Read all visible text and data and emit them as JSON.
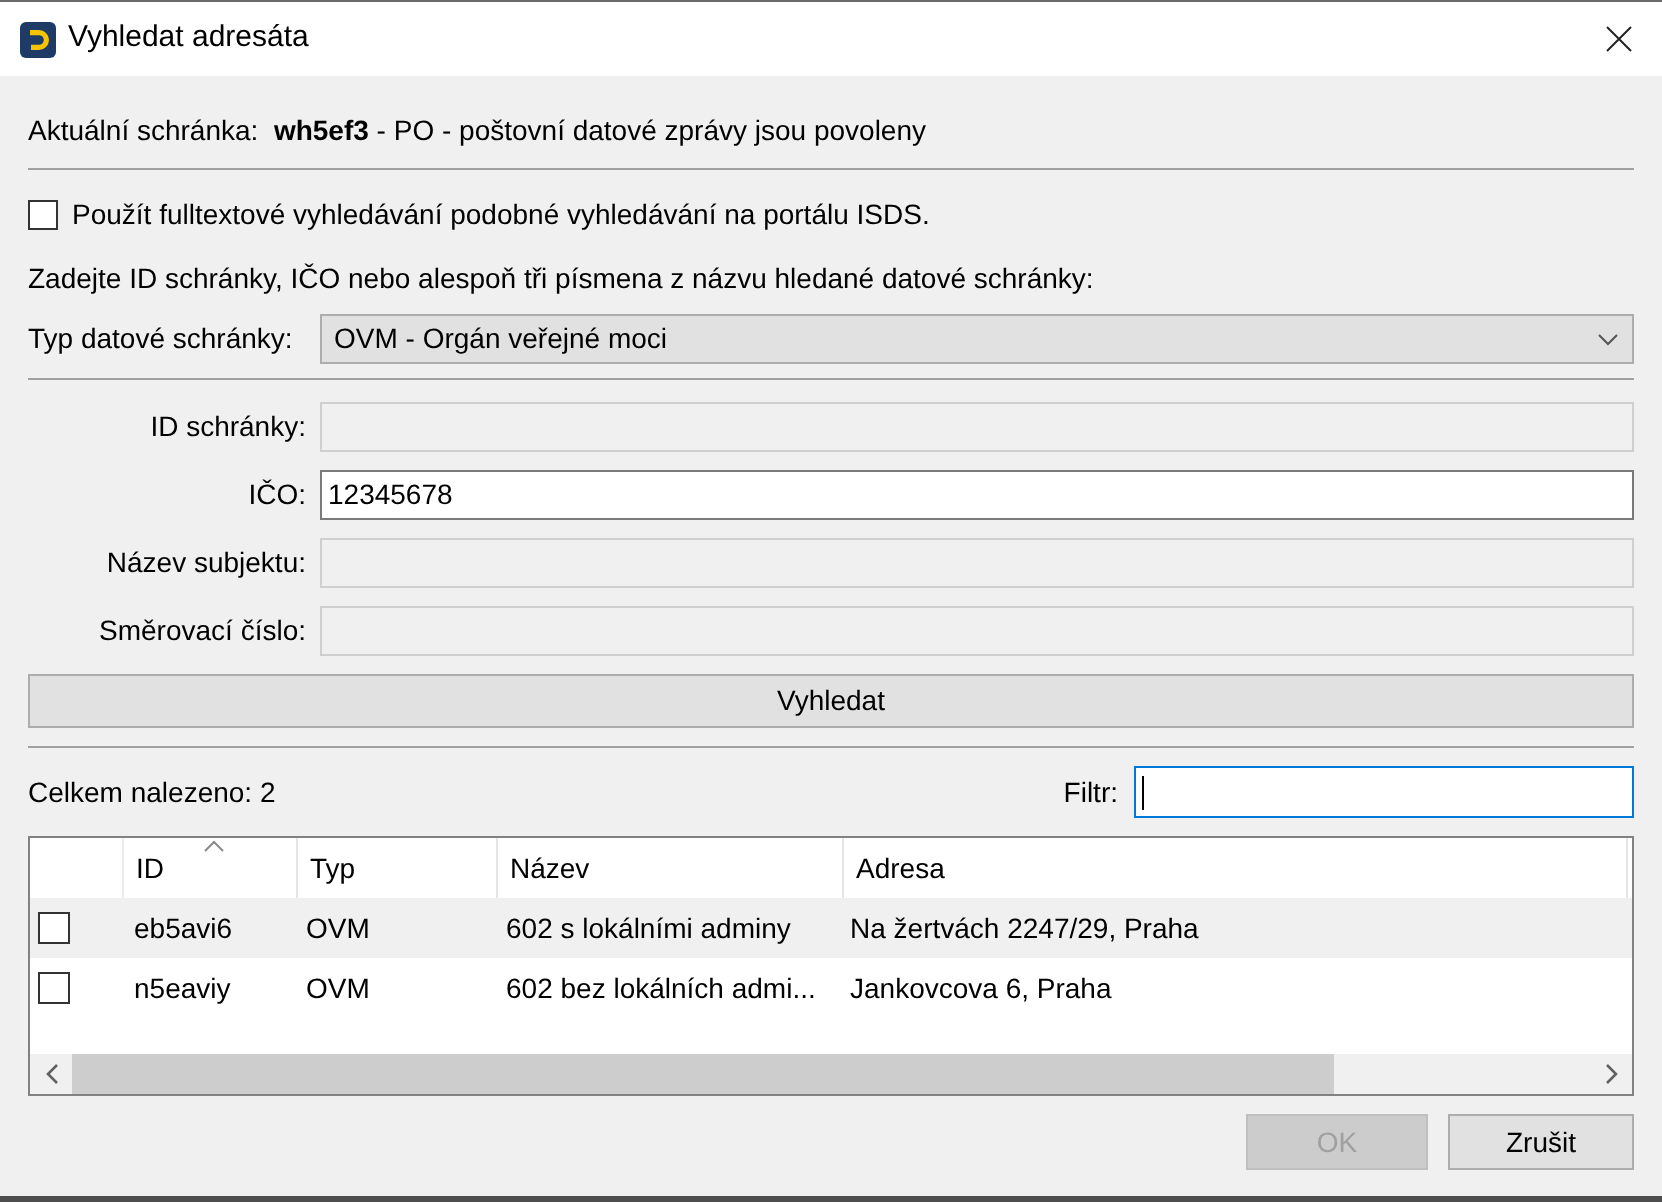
{
  "window": {
    "title": "Vyhledat adresáta"
  },
  "current_box": "Aktuální schránka:  **wh5ef3** - PO - poštovní datové zprávy jsou povoleny",
  "fulltext_option": {
    "label": "Použít fulltextové vyhledávání podobné vyhledávání na portálu ISDS.",
    "checked": false
  },
  "instructions": "Zadejte ID schránky, IČO nebo alespoň tři písmena z názvu hledané datové schránky:",
  "box_type": {
    "label": "Typ datové schránky:",
    "value": "OVM - Orgán veřejné moci"
  },
  "fields": [
    {
      "label": "ID schránky:",
      "disabled": true
    },
    {
      "label": "IČO:",
      "value": "12345678",
      "disabled": false
    },
    {
      "label": "Název subjektu:",
      "disabled": true
    },
    {
      "label": "Směrovací číslo:",
      "disabled": true
    }
  ],
  "search_button": "Vyhledat",
  "results_count": "Celkem nalezeno: 2",
  "filter": {
    "label": "Filtr:",
    "focused": true
  },
  "table": {
    "columns": [
      {
        "label": "ID",
        "sorted": true
      },
      {
        "label": "Typ",
        "sorted": false
      },
      {
        "label": "Název",
        "sorted": false
      },
      {
        "label": "Adresa",
        "sorted": false
      }
    ],
    "rows": [
      {
        "checked": false,
        "cells": [
          "eb5avi6",
          "OVM",
          "602 s lokálními adminy",
          "Na žertvách 2247/29, Praha"
        ]
      },
      {
        "checked": false,
        "cells": [
          "n5eaviy",
          "OVM",
          "602 bez lokálních admi...",
          "Jankovcova 6, Praha"
        ]
      }
    ]
  },
  "buttons": [
    {
      "label": "OK",
      "disabled": true
    },
    {
      "label": "Zrušit",
      "disabled": false
    }
  ]
}
